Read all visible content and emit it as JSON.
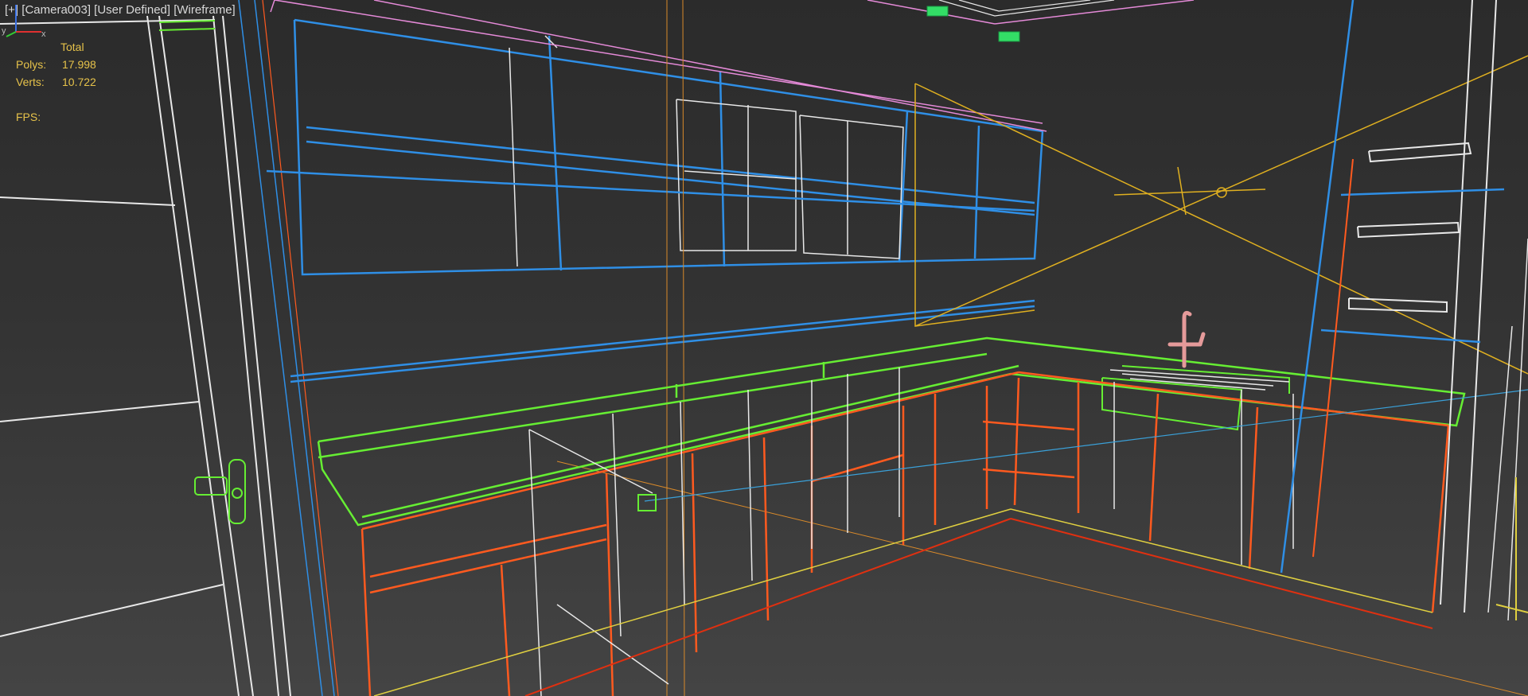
{
  "viewport": {
    "label": {
      "plus": "[+]",
      "camera": "[Camera003]",
      "view_mode": "[User Defined]",
      "shading": "[Wireframe]"
    },
    "stats": {
      "total_label": "Total",
      "polys_label": "Polys:",
      "polys_value": "17.998",
      "verts_label": "Verts:",
      "verts_value": "10.722",
      "fps_label": "FPS:",
      "fps_value": ""
    },
    "axis": {
      "x_label": "x",
      "y_label": "y"
    },
    "colors": {
      "background": "#333333",
      "stats_text": "#e6c24a",
      "wire_white": "#e8e8e8",
      "wire_blue": "#2f8fe6",
      "wire_green": "#66ee33",
      "wire_orange": "#ff5a1f",
      "wire_yellow": "#e0b020",
      "wire_pink": "#e58ad8",
      "faucet": "#e59a9a"
    }
  }
}
